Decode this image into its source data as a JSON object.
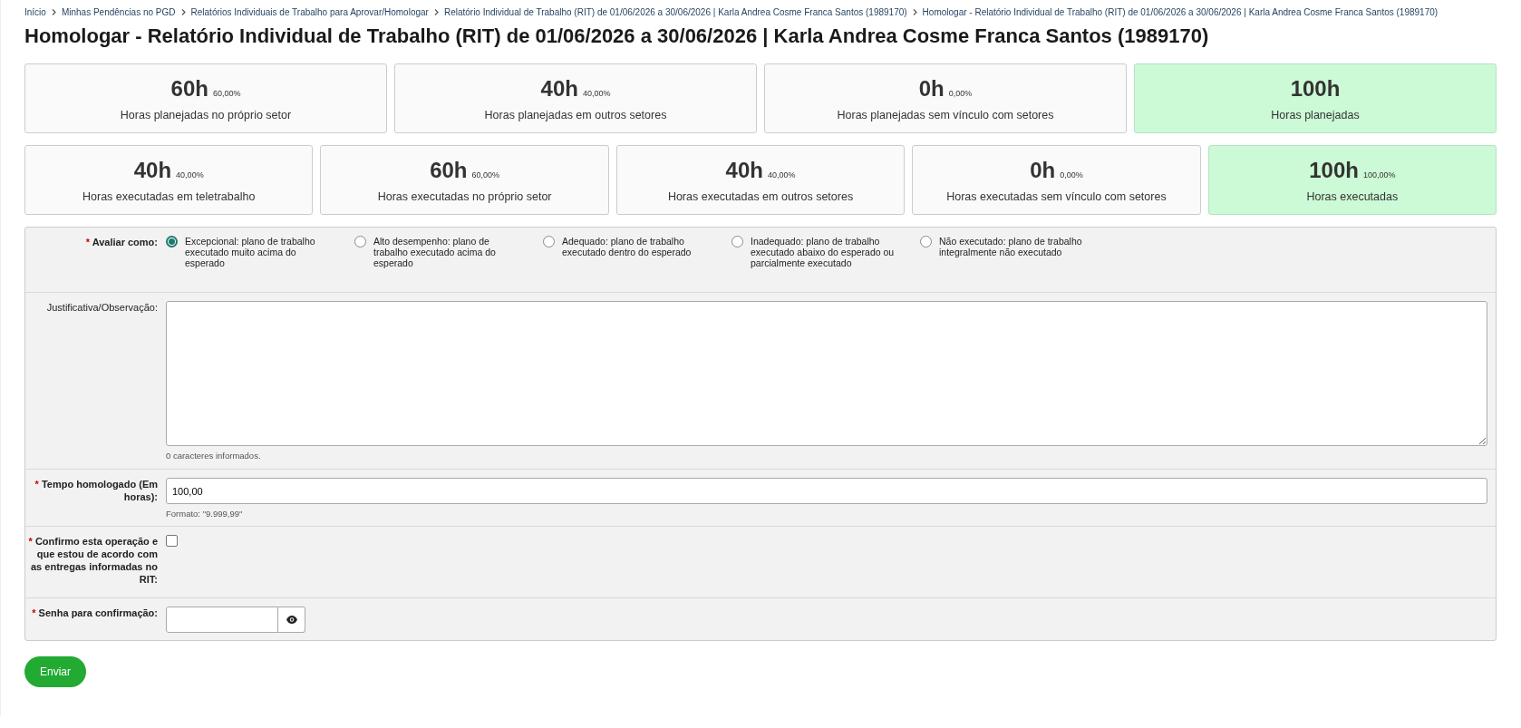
{
  "breadcrumb": [
    "Início",
    "Minhas Pendências no PGD",
    "Relatórios Individuais de Trabalho para Aprovar/Homologar",
    "Relatório Individual de Trabalho (RIT) de 01/06/2026 a 30/06/2026 | Karla Andrea Cosme Franca Santos (1989170)",
    "Homologar - Relatório Individual de Trabalho (RIT) de 01/06/2026 a 30/06/2026 | Karla Andrea Cosme Franca Santos (1989170)"
  ],
  "title": "Homologar - Relatório Individual de Trabalho (RIT) de 01/06/2026 a 30/06/2026 | Karla Andrea Cosme Franca Santos (1989170)",
  "card_rows": [
    {
      "cards": [
        {
          "kind": "part",
          "value": "60h",
          "percent": "60,00%",
          "label": "Horas planejadas no próprio setor"
        },
        {
          "kind": "part",
          "value": "40h",
          "percent": "40,00%",
          "label": "Horas planejadas em outros setores"
        },
        {
          "kind": "part",
          "value": "0h",
          "percent": "0,00%",
          "label": "Horas planejadas sem vínculo com setores"
        },
        {
          "kind": "total",
          "value": "100h",
          "label": "Horas planejadas"
        }
      ]
    },
    {
      "cards": [
        {
          "kind": "part",
          "value": "40h",
          "percent": "40,00%",
          "label": "Horas executadas em teletrabalho"
        },
        {
          "kind": "part",
          "value": "60h",
          "percent": "60,00%",
          "label": "Horas executadas no próprio setor"
        },
        {
          "kind": "part",
          "value": "40h",
          "percent": "40,00%",
          "label": "Horas executadas em outros setores"
        },
        {
          "kind": "part",
          "value": "0h",
          "percent": "0,00%",
          "label": "Horas executadas sem vínculo com setores"
        },
        {
          "kind": "total",
          "value": "100h",
          "percent": "100,00%",
          "label": "Horas executadas"
        }
      ]
    }
  ],
  "form": [
    {
      "kind": "radio",
      "required_mark": "*",
      "label": "Avaliar como:",
      "options": [
        {
          "label": "Excepcional: plano de trabalho executado muito acima do esperado",
          "selected": true
        },
        {
          "label": "Alto desempenho: plano de trabalho executado acima do esperado",
          "selected": false
        },
        {
          "label": "Adequado: plano de trabalho executado dentro do esperado",
          "selected": false
        },
        {
          "label": "Inadequado: plano de trabalho executado abaixo do esperado ou parcialmente executado",
          "selected": false
        },
        {
          "label": "Não executado: plano de trabalho integralmente não executado",
          "selected": false
        }
      ]
    },
    {
      "kind": "textarea",
      "label": "Justificativa/Observação:",
      "hint": "0 caracteres informados."
    },
    {
      "kind": "text",
      "required_mark": "*",
      "label": "Tempo homologado (Em horas):",
      "value": "100,00",
      "hint": "Formato: \"9.999,99\""
    },
    {
      "kind": "checkbox",
      "required_mark": "*",
      "label": "Confirmo esta operação e que estou de acordo com as entregas informadas no RIT:",
      "checked": false
    },
    {
      "kind": "password",
      "required_mark": "*",
      "label": "Senha para confirmação:"
    }
  ],
  "submit": "Enviar"
}
